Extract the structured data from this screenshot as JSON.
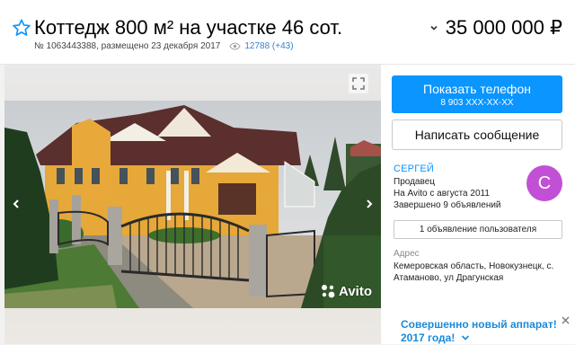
{
  "listing": {
    "title": "Коттедж 800 м² на участке 46 сот.",
    "price": "35 000 000 ₽",
    "number": "№ 1063443388, размещено 23 декабря 2017",
    "views": "12788 (+43)"
  },
  "gallery": {
    "watermark": "Avito"
  },
  "contact": {
    "phone_button": "Показать телефон",
    "phone_masked": "8 903 XXX-XX-XX",
    "message_button": "Написать сообщение"
  },
  "seller": {
    "name": "СЕРГЕЙ",
    "role": "Продавец",
    "since": "На Avito с августа 2011",
    "completed": "Завершено 9 объявлений",
    "avatar_letter": "С",
    "ads_button": "1 объявление пользователя"
  },
  "address": {
    "label": "Адрес",
    "value": "Кемеровская область, Новокузнецк, с. Атаманово, ул Драгунская"
  },
  "promo": {
    "text": "Совершенно новый аппарат! 2017 года!"
  },
  "colors": {
    "accent": "#0a95ff",
    "avatar": "#c250d6",
    "link": "#3a82c9"
  },
  "icons": [
    "star-outline-icon",
    "chevron-down-icon",
    "eye-icon",
    "expand-icon",
    "arrow-left-icon",
    "arrow-right-icon",
    "avito-logo-icon",
    "close-icon"
  ]
}
